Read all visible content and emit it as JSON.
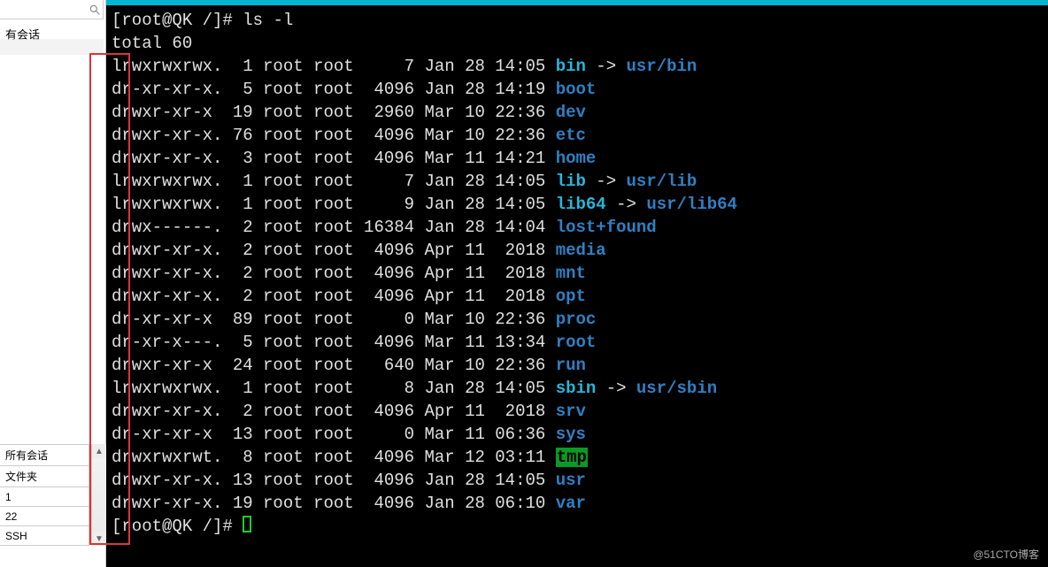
{
  "sidebar": {
    "session_label": "有会话",
    "table_header": "所有会话",
    "rows": [
      "文件夹",
      "1",
      "22",
      "SSH"
    ]
  },
  "terminal": {
    "prompt1": "[root@QK /]# ",
    "cmd": "ls -l",
    "total": "total 60",
    "prompt2": "[root@QK /]# ",
    "entries": [
      {
        "perm": "lrwxrwxrwx.",
        "links": "1",
        "own": "root",
        "grp": "root",
        "size": "7",
        "date": "Jan 28 14:05",
        "name": "bin",
        "sym": " -> ",
        "target": "usr/bin",
        "name_style": "cyan",
        "target_style": "blue"
      },
      {
        "perm": "dr-xr-xr-x.",
        "links": "5",
        "own": "root",
        "grp": "root",
        "size": "4096",
        "date": "Jan 28 14:19",
        "name": "boot",
        "name_style": "blue"
      },
      {
        "perm": "drwxr-xr-x",
        "links": "19",
        "own": "root",
        "grp": "root",
        "size": "2960",
        "date": "Mar 10 22:36",
        "name": "dev",
        "name_style": "blue"
      },
      {
        "perm": "drwxr-xr-x.",
        "links": "76",
        "own": "root",
        "grp": "root",
        "size": "4096",
        "date": "Mar 10 22:36",
        "name": "etc",
        "name_style": "blue"
      },
      {
        "perm": "drwxr-xr-x.",
        "links": "3",
        "own": "root",
        "grp": "root",
        "size": "4096",
        "date": "Mar 11 14:21",
        "name": "home",
        "name_style": "blue"
      },
      {
        "perm": "lrwxrwxrwx.",
        "links": "1",
        "own": "root",
        "grp": "root",
        "size": "7",
        "date": "Jan 28 14:05",
        "name": "lib",
        "sym": " -> ",
        "target": "usr/lib",
        "name_style": "cyan",
        "target_style": "blue"
      },
      {
        "perm": "lrwxrwxrwx.",
        "links": "1",
        "own": "root",
        "grp": "root",
        "size": "9",
        "date": "Jan 28 14:05",
        "name": "lib64",
        "sym": " -> ",
        "target": "usr/lib64",
        "name_style": "cyan",
        "target_style": "blue"
      },
      {
        "perm": "drwx------.",
        "links": "2",
        "own": "root",
        "grp": "root",
        "size": "16384",
        "date": "Jan 28 14:04",
        "name": "lost+found",
        "name_style": "blue"
      },
      {
        "perm": "drwxr-xr-x.",
        "links": "2",
        "own": "root",
        "grp": "root",
        "size": "4096",
        "date": "Apr 11  2018",
        "name": "media",
        "name_style": "blue"
      },
      {
        "perm": "drwxr-xr-x.",
        "links": "2",
        "own": "root",
        "grp": "root",
        "size": "4096",
        "date": "Apr 11  2018",
        "name": "mnt",
        "name_style": "blue"
      },
      {
        "perm": "drwxr-xr-x.",
        "links": "2",
        "own": "root",
        "grp": "root",
        "size": "4096",
        "date": "Apr 11  2018",
        "name": "opt",
        "name_style": "blue"
      },
      {
        "perm": "dr-xr-xr-x",
        "links": "89",
        "own": "root",
        "grp": "root",
        "size": "0",
        "date": "Mar 10 22:36",
        "name": "proc",
        "name_style": "blue"
      },
      {
        "perm": "dr-xr-x---.",
        "links": "5",
        "own": "root",
        "grp": "root",
        "size": "4096",
        "date": "Mar 11 13:34",
        "name": "root",
        "name_style": "blue"
      },
      {
        "perm": "drwxr-xr-x",
        "links": "24",
        "own": "root",
        "grp": "root",
        "size": "640",
        "date": "Mar 10 22:36",
        "name": "run",
        "name_style": "blue"
      },
      {
        "perm": "lrwxrwxrwx.",
        "links": "1",
        "own": "root",
        "grp": "root",
        "size": "8",
        "date": "Jan 28 14:05",
        "name": "sbin",
        "sym": " -> ",
        "target": "usr/sbin",
        "name_style": "cyan",
        "target_style": "blue"
      },
      {
        "perm": "drwxr-xr-x.",
        "links": "2",
        "own": "root",
        "grp": "root",
        "size": "4096",
        "date": "Apr 11  2018",
        "name": "srv",
        "name_style": "blue"
      },
      {
        "perm": "dr-xr-xr-x",
        "links": "13",
        "own": "root",
        "grp": "root",
        "size": "0",
        "date": "Mar 11 06:36",
        "name": "sys",
        "name_style": "blue"
      },
      {
        "perm": "drwxrwxrwt.",
        "links": "8",
        "own": "root",
        "grp": "root",
        "size": "4096",
        "date": "Mar 12 03:11",
        "name": "tmp",
        "name_style": "greenbg"
      },
      {
        "perm": "drwxr-xr-x.",
        "links": "13",
        "own": "root",
        "grp": "root",
        "size": "4096",
        "date": "Jan 28 14:05",
        "name": "usr",
        "name_style": "blue"
      },
      {
        "perm": "drwxr-xr-x.",
        "links": "19",
        "own": "root",
        "grp": "root",
        "size": "4096",
        "date": "Jan 28 06:10",
        "name": "var",
        "name_style": "blue"
      }
    ]
  },
  "watermark": "@51CTO博客"
}
